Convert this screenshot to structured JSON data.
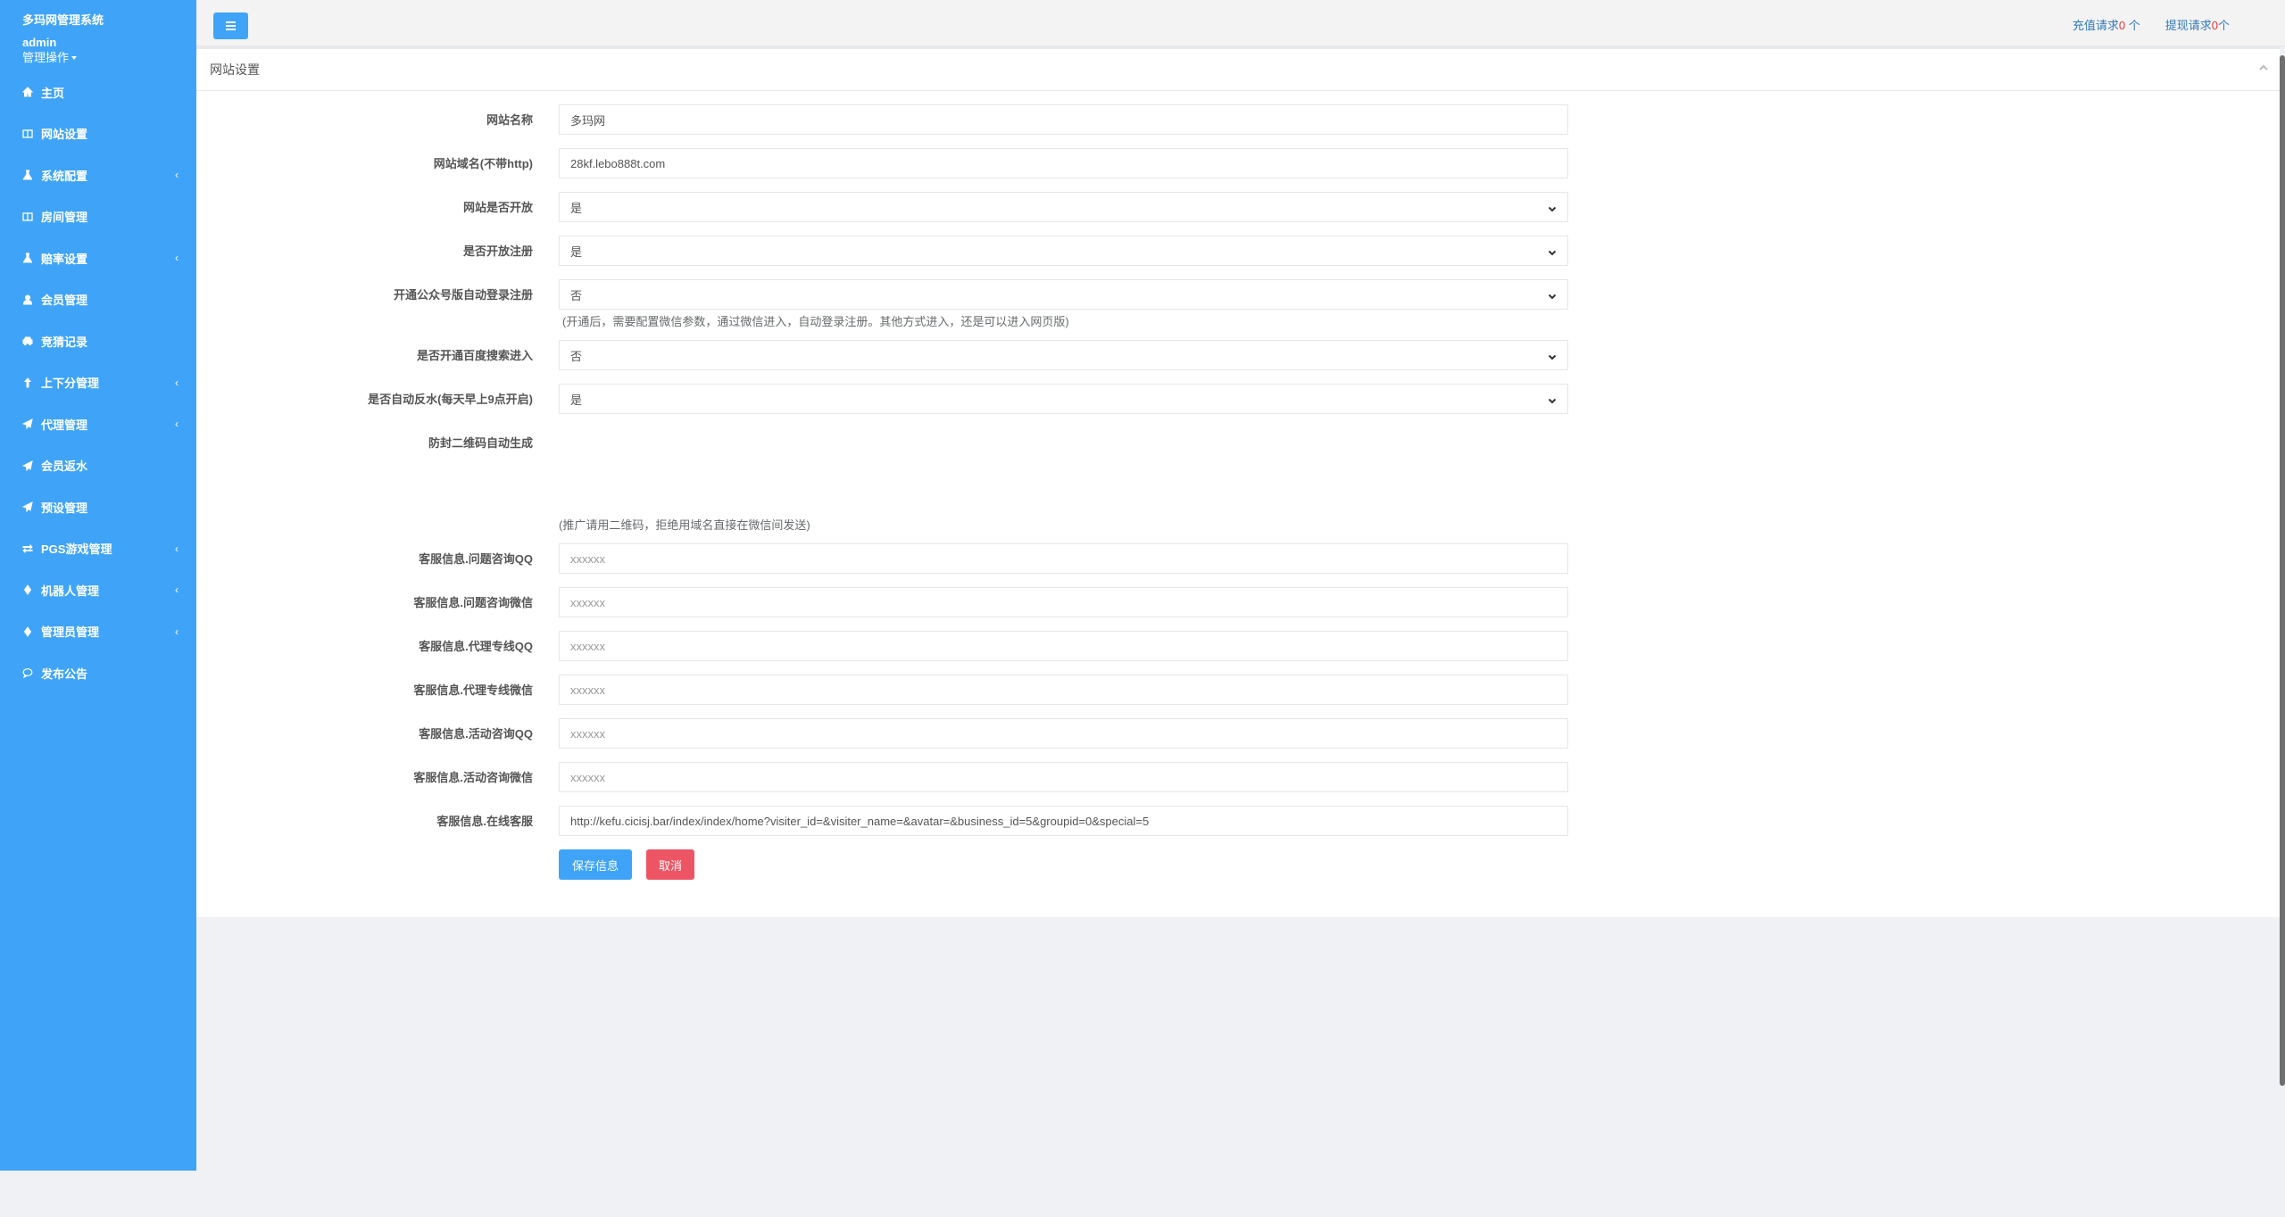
{
  "sidebar": {
    "system_title": "多玛网管理系统",
    "username": "admin",
    "ops_label": "管理操作",
    "items": [
      {
        "label": "主页",
        "icon": "home-icon",
        "has_sub": false
      },
      {
        "label": "网站设置",
        "icon": "columns-icon",
        "has_sub": false
      },
      {
        "label": "系统配置",
        "icon": "flask-icon",
        "has_sub": true
      },
      {
        "label": "房间管理",
        "icon": "columns-icon",
        "has_sub": false
      },
      {
        "label": "赔率设置",
        "icon": "flask-icon",
        "has_sub": true
      },
      {
        "label": "会员管理",
        "icon": "user-icon",
        "has_sub": false
      },
      {
        "label": "竞猜记录",
        "icon": "car-icon",
        "has_sub": false
      },
      {
        "label": "上下分管理",
        "icon": "level-up-icon",
        "has_sub": true
      },
      {
        "label": "代理管理",
        "icon": "paper-plane-icon",
        "has_sub": true
      },
      {
        "label": "会员返水",
        "icon": "paper-plane-icon",
        "has_sub": false
      },
      {
        "label": "预设管理",
        "icon": "paper-plane-icon",
        "has_sub": false
      },
      {
        "label": "PGS游戏管理",
        "icon": "exchange-icon",
        "has_sub": true
      },
      {
        "label": "机器人管理",
        "icon": "diamond-icon",
        "has_sub": true
      },
      {
        "label": "管理员管理",
        "icon": "diamond-icon",
        "has_sub": true
      },
      {
        "label": "发布公告",
        "icon": "comment-icon",
        "has_sub": false
      }
    ],
    "arrow": "‹"
  },
  "topbar": {
    "recharge_label": "充值请求",
    "recharge_count": "0",
    "recharge_unit": " 个",
    "withdraw_label": "提现请求",
    "withdraw_count": "0",
    "withdraw_unit": "个"
  },
  "panel": {
    "title": "网站设置"
  },
  "form": {
    "site_name": {
      "label": "网站名称",
      "value": "多玛网"
    },
    "site_domain": {
      "label": "网站域名(不带http)",
      "value": "28kf.lebo888t.com"
    },
    "site_open": {
      "label": "网站是否开放",
      "value": "是"
    },
    "register_open": {
      "label": "是否开放注册",
      "value": "是"
    },
    "wechat_auto": {
      "label": "开通公众号版自动登录注册",
      "value": "否",
      "help": "(开通后，需要配置微信参数，通过微信进入，自动登录注册。其他方式进入，还是可以进入网页版)"
    },
    "baidu_search": {
      "label": "是否开通百度搜索进入",
      "value": "否"
    },
    "auto_rebate": {
      "label": "是否自动反水(每天早上9点开启)",
      "value": "是"
    },
    "qrcode": {
      "label": "防封二维码自动生成",
      "help": "(推广请用二维码，拒绝用域名直接在微信间发送)"
    },
    "cs_issue_qq": {
      "label": "客服信息.问题咨询QQ",
      "placeholder": "xxxxxx"
    },
    "cs_issue_wechat": {
      "label": "客服信息.问题咨询微信",
      "placeholder": "xxxxxx"
    },
    "cs_agent_qq": {
      "label": "客服信息.代理专线QQ",
      "placeholder": "xxxxxx"
    },
    "cs_agent_wechat": {
      "label": "客服信息.代理专线微信",
      "placeholder": "xxxxxx"
    },
    "cs_event_qq": {
      "label": "客服信息.活动咨询QQ",
      "placeholder": "xxxxxx"
    },
    "cs_event_wechat": {
      "label": "客服信息.活动咨询微信",
      "placeholder": "xxxxxx"
    },
    "cs_online": {
      "label": "客服信息.在线客服",
      "value": "http://kefu.cicisj.bar/index/index/home?visiter_id=&visiter_name=&avatar=&business_id=5&groupid=0&special=5"
    },
    "save_label": "保存信息",
    "cancel_label": "取消"
  },
  "colors": {
    "accent": "#3fa4f7",
    "danger": "#ed5565",
    "count": "#e33333"
  }
}
